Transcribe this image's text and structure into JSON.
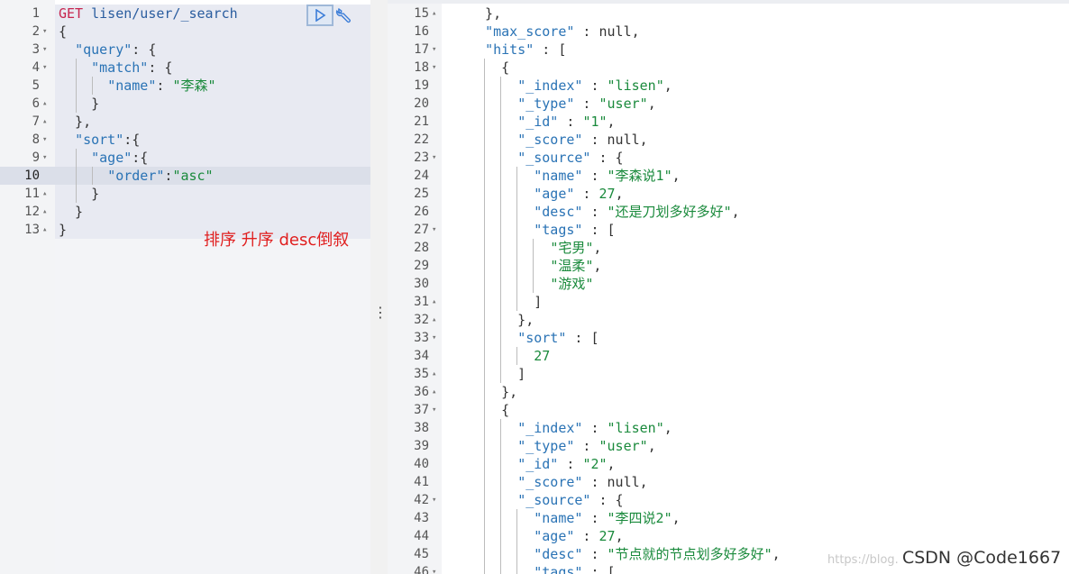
{
  "request_editor": {
    "run_button_icon": "play-icon",
    "settings_icon": "wrench-icon",
    "lines": [
      {
        "n": "1",
        "fold": "",
        "tokens": [
          [
            "method",
            "GET"
          ],
          [
            "path",
            " lisen/user/_search"
          ]
        ]
      },
      {
        "n": "2",
        "fold": "▾",
        "tokens": [
          [
            "punc",
            "{"
          ]
        ]
      },
      {
        "n": "3",
        "fold": "▾",
        "tokens": [
          [
            "punc",
            "  "
          ],
          [
            "key",
            "\"query\""
          ],
          [
            "punc",
            ": {"
          ]
        ]
      },
      {
        "n": "4",
        "fold": "▾",
        "tokens": [
          [
            "punc",
            "    "
          ],
          [
            "key",
            "\"match\""
          ],
          [
            "punc",
            ": {"
          ]
        ]
      },
      {
        "n": "5",
        "fold": "",
        "tokens": [
          [
            "punc",
            "      "
          ],
          [
            "key",
            "\"name\""
          ],
          [
            "punc",
            ": "
          ],
          [
            "str",
            "\"李森\""
          ]
        ]
      },
      {
        "n": "6",
        "fold": "▴",
        "tokens": [
          [
            "punc",
            "    }"
          ]
        ]
      },
      {
        "n": "7",
        "fold": "▴",
        "tokens": [
          [
            "punc",
            "  },"
          ]
        ]
      },
      {
        "n": "8",
        "fold": "▾",
        "tokens": [
          [
            "punc",
            "  "
          ],
          [
            "key",
            "\"sort\""
          ],
          [
            "punc",
            ":{"
          ]
        ]
      },
      {
        "n": "9",
        "fold": "▾",
        "tokens": [
          [
            "punc",
            "    "
          ],
          [
            "key",
            "\"age\""
          ],
          [
            "punc",
            ":{"
          ]
        ]
      },
      {
        "n": "10",
        "fold": "",
        "tokens": [
          [
            "punc",
            "      "
          ],
          [
            "key",
            "\"order\""
          ],
          [
            "punc",
            ":"
          ],
          [
            "str",
            "\"asc\""
          ]
        ]
      },
      {
        "n": "11",
        "fold": "▴",
        "tokens": [
          [
            "punc",
            "    }"
          ]
        ]
      },
      {
        "n": "12",
        "fold": "▴",
        "tokens": [
          [
            "punc",
            "  }"
          ]
        ]
      },
      {
        "n": "13",
        "fold": "▴",
        "tokens": [
          [
            "punc",
            "}"
          ]
        ]
      }
    ],
    "annotation": "排序 升序 desc倒叙"
  },
  "resizer": {
    "icon": "⋮"
  },
  "response_viewer": {
    "lines": [
      {
        "n": "15",
        "fold": "▴",
        "tokens": [
          [
            "punc",
            "  },"
          ]
        ]
      },
      {
        "n": "16",
        "fold": "",
        "tokens": [
          [
            "punc",
            "  "
          ],
          [
            "key",
            "\"max_score\""
          ],
          [
            "punc",
            " : null,"
          ]
        ]
      },
      {
        "n": "17",
        "fold": "▾",
        "tokens": [
          [
            "punc",
            "  "
          ],
          [
            "key",
            "\"hits\""
          ],
          [
            "punc",
            " : ["
          ]
        ]
      },
      {
        "n": "18",
        "fold": "▾",
        "tokens": [
          [
            "punc",
            "    {"
          ]
        ]
      },
      {
        "n": "19",
        "fold": "",
        "tokens": [
          [
            "punc",
            "      "
          ],
          [
            "key",
            "\"_index\""
          ],
          [
            "punc",
            " : "
          ],
          [
            "str",
            "\"lisen\""
          ],
          [
            "punc",
            ","
          ]
        ]
      },
      {
        "n": "20",
        "fold": "",
        "tokens": [
          [
            "punc",
            "      "
          ],
          [
            "key",
            "\"_type\""
          ],
          [
            "punc",
            " : "
          ],
          [
            "str",
            "\"user\""
          ],
          [
            "punc",
            ","
          ]
        ]
      },
      {
        "n": "21",
        "fold": "",
        "tokens": [
          [
            "punc",
            "      "
          ],
          [
            "key",
            "\"_id\""
          ],
          [
            "punc",
            " : "
          ],
          [
            "str",
            "\"1\""
          ],
          [
            "punc",
            ","
          ]
        ]
      },
      {
        "n": "22",
        "fold": "",
        "tokens": [
          [
            "punc",
            "      "
          ],
          [
            "key",
            "\"_score\""
          ],
          [
            "punc",
            " : null,"
          ]
        ]
      },
      {
        "n": "23",
        "fold": "▾",
        "tokens": [
          [
            "punc",
            "      "
          ],
          [
            "key",
            "\"_source\""
          ],
          [
            "punc",
            " : {"
          ]
        ]
      },
      {
        "n": "24",
        "fold": "",
        "tokens": [
          [
            "punc",
            "        "
          ],
          [
            "key",
            "\"name\""
          ],
          [
            "punc",
            " : "
          ],
          [
            "str",
            "\"李森说1\""
          ],
          [
            "punc",
            ","
          ]
        ]
      },
      {
        "n": "25",
        "fold": "",
        "tokens": [
          [
            "punc",
            "        "
          ],
          [
            "key",
            "\"age\""
          ],
          [
            "punc",
            " : "
          ],
          [
            "num",
            "27"
          ],
          [
            "punc",
            ","
          ]
        ]
      },
      {
        "n": "26",
        "fold": "",
        "tokens": [
          [
            "punc",
            "        "
          ],
          [
            "key",
            "\"desc\""
          ],
          [
            "punc",
            " : "
          ],
          [
            "str",
            "\"还是刀划多好多好\""
          ],
          [
            "punc",
            ","
          ]
        ]
      },
      {
        "n": "27",
        "fold": "▾",
        "tokens": [
          [
            "punc",
            "        "
          ],
          [
            "key",
            "\"tags\""
          ],
          [
            "punc",
            " : ["
          ]
        ]
      },
      {
        "n": "28",
        "fold": "",
        "tokens": [
          [
            "punc",
            "          "
          ],
          [
            "str",
            "\"宅男\""
          ],
          [
            "punc",
            ","
          ]
        ]
      },
      {
        "n": "29",
        "fold": "",
        "tokens": [
          [
            "punc",
            "          "
          ],
          [
            "str",
            "\"温柔\""
          ],
          [
            "punc",
            ","
          ]
        ]
      },
      {
        "n": "30",
        "fold": "",
        "tokens": [
          [
            "punc",
            "          "
          ],
          [
            "str",
            "\"游戏\""
          ]
        ]
      },
      {
        "n": "31",
        "fold": "▴",
        "tokens": [
          [
            "punc",
            "        ]"
          ]
        ]
      },
      {
        "n": "32",
        "fold": "▴",
        "tokens": [
          [
            "punc",
            "      },"
          ]
        ]
      },
      {
        "n": "33",
        "fold": "▾",
        "tokens": [
          [
            "punc",
            "      "
          ],
          [
            "key",
            "\"sort\""
          ],
          [
            "punc",
            " : ["
          ]
        ]
      },
      {
        "n": "34",
        "fold": "",
        "tokens": [
          [
            "punc",
            "        "
          ],
          [
            "num",
            "27"
          ]
        ]
      },
      {
        "n": "35",
        "fold": "▴",
        "tokens": [
          [
            "punc",
            "      ]"
          ]
        ]
      },
      {
        "n": "36",
        "fold": "▴",
        "tokens": [
          [
            "punc",
            "    },"
          ]
        ]
      },
      {
        "n": "37",
        "fold": "▾",
        "tokens": [
          [
            "punc",
            "    {"
          ]
        ]
      },
      {
        "n": "38",
        "fold": "",
        "tokens": [
          [
            "punc",
            "      "
          ],
          [
            "key",
            "\"_index\""
          ],
          [
            "punc",
            " : "
          ],
          [
            "str",
            "\"lisen\""
          ],
          [
            "punc",
            ","
          ]
        ]
      },
      {
        "n": "39",
        "fold": "",
        "tokens": [
          [
            "punc",
            "      "
          ],
          [
            "key",
            "\"_type\""
          ],
          [
            "punc",
            " : "
          ],
          [
            "str",
            "\"user\""
          ],
          [
            "punc",
            ","
          ]
        ]
      },
      {
        "n": "40",
        "fold": "",
        "tokens": [
          [
            "punc",
            "      "
          ],
          [
            "key",
            "\"_id\""
          ],
          [
            "punc",
            " : "
          ],
          [
            "str",
            "\"2\""
          ],
          [
            "punc",
            ","
          ]
        ]
      },
      {
        "n": "41",
        "fold": "",
        "tokens": [
          [
            "punc",
            "      "
          ],
          [
            "key",
            "\"_score\""
          ],
          [
            "punc",
            " : null,"
          ]
        ]
      },
      {
        "n": "42",
        "fold": "▾",
        "tokens": [
          [
            "punc",
            "      "
          ],
          [
            "key",
            "\"_source\""
          ],
          [
            "punc",
            " : {"
          ]
        ]
      },
      {
        "n": "43",
        "fold": "",
        "tokens": [
          [
            "punc",
            "        "
          ],
          [
            "key",
            "\"name\""
          ],
          [
            "punc",
            " : "
          ],
          [
            "str",
            "\"李四说2\""
          ],
          [
            "punc",
            ","
          ]
        ]
      },
      {
        "n": "44",
        "fold": "",
        "tokens": [
          [
            "punc",
            "        "
          ],
          [
            "key",
            "\"age\""
          ],
          [
            "punc",
            " : "
          ],
          [
            "num",
            "27"
          ],
          [
            "punc",
            ","
          ]
        ]
      },
      {
        "n": "45",
        "fold": "",
        "tokens": [
          [
            "punc",
            "        "
          ],
          [
            "key",
            "\"desc\""
          ],
          [
            "punc",
            " : "
          ],
          [
            "str",
            "\"节点就的节点划多好多好\""
          ],
          [
            "punc",
            ","
          ]
        ]
      },
      {
        "n": "46",
        "fold": "▾",
        "tokens": [
          [
            "punc",
            "        "
          ],
          [
            "key",
            "\"tags\""
          ],
          [
            "punc",
            " : ["
          ]
        ]
      }
    ]
  },
  "watermark": {
    "faint": "https://blog.",
    "brand": "CSDN @Code1667"
  }
}
